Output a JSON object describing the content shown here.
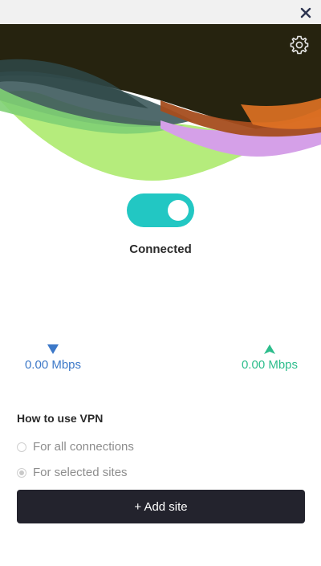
{
  "colors": {
    "toggle_on": "#22c7c3",
    "download": "#3c78c8",
    "upload": "#2dbd8c",
    "button_bg": "#23232d",
    "hero_dark": "#26230f"
  },
  "icons": {
    "close": "close-icon",
    "settings": "gear-icon",
    "download": "triangle-down-icon",
    "upload": "triangle-up-icon"
  },
  "connection": {
    "toggle_state": "on",
    "status_label": "Connected"
  },
  "speeds": {
    "download": "0.00 Mbps",
    "upload": "0.00 Mbps"
  },
  "usage": {
    "title": "How to use VPN",
    "options": [
      {
        "label": "For all connections",
        "selected": false
      },
      {
        "label": "For selected sites",
        "selected": true
      }
    ]
  },
  "actions": {
    "add_site_label": "+ Add site"
  }
}
